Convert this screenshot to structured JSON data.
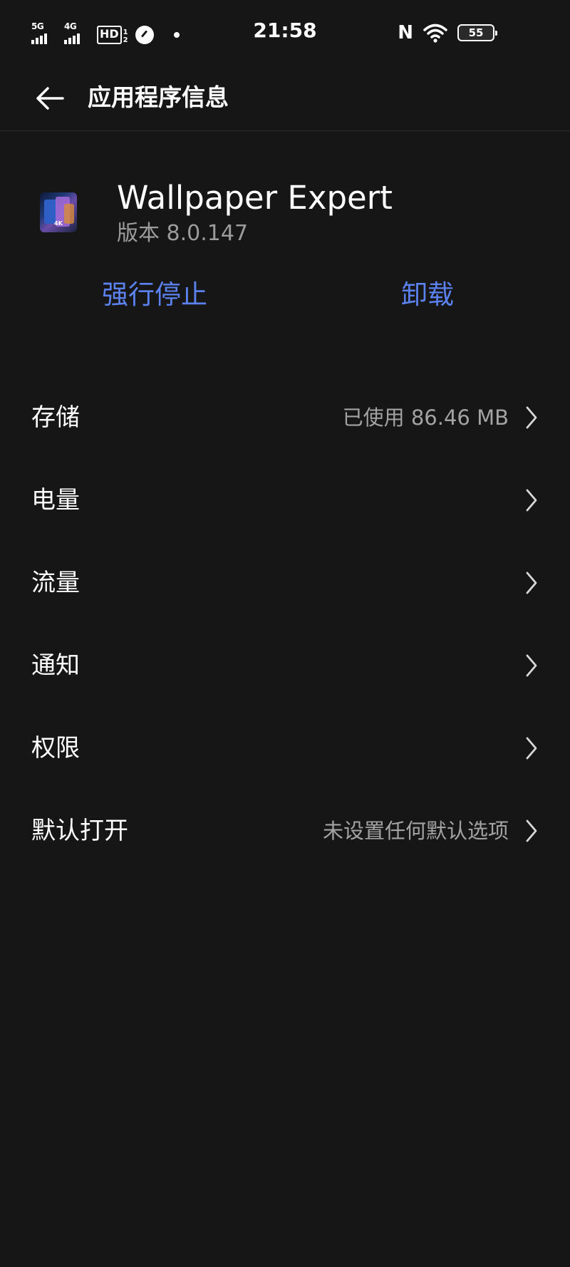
{
  "status_bar": {
    "signal1_label": "5G",
    "signal2_label": "4G",
    "hd_label": "HD",
    "hd_sub": "1\n2",
    "time": "21:58",
    "nfc_label": "N",
    "battery_level": "55",
    "icons": [
      "signal-5g-icon",
      "signal-4g-icon",
      "hd-voice-icon",
      "speed-gauge-icon",
      "notification-dot-icon",
      "nfc-icon",
      "wifi-icon",
      "battery-icon"
    ]
  },
  "header": {
    "title": "应用程序信息",
    "back_icon": "arrow-left-icon"
  },
  "app": {
    "name": "Wallpaper Expert",
    "version": "版本 8.0.147",
    "icon_badge": "4K"
  },
  "actions": {
    "force_stop": "强行停止",
    "uninstall": "卸载"
  },
  "settings": [
    {
      "label": "存储",
      "value": "已使用 86.46 MB"
    },
    {
      "label": "电量",
      "value": ""
    },
    {
      "label": "流量",
      "value": ""
    },
    {
      "label": "通知",
      "value": ""
    },
    {
      "label": "权限",
      "value": ""
    },
    {
      "label": "默认打开",
      "value": "未设置任何默认选项"
    }
  ],
  "colors": {
    "background": "#161616",
    "accent": "#5b82f0",
    "secondary_text": "#a3a3a3"
  }
}
